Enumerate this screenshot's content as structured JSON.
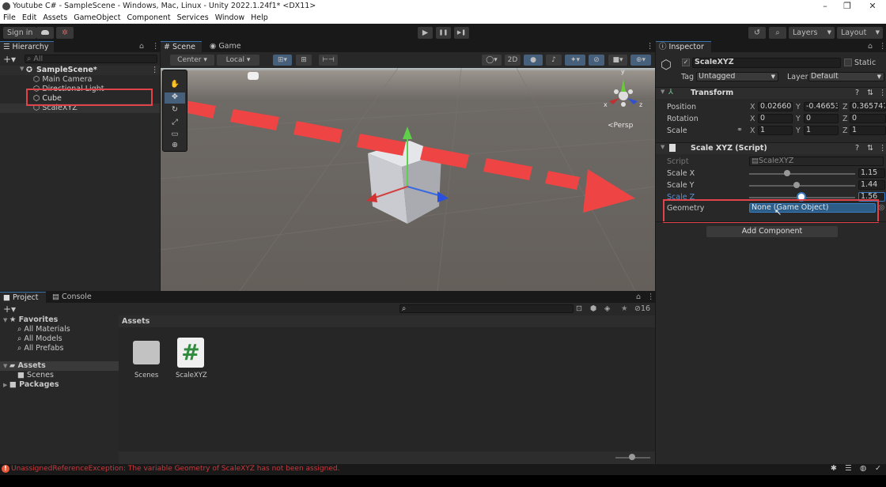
{
  "window": {
    "title": "Youtube C# - SampleScene - Windows, Mac, Linux - Unity 2022.1.24f1* <DX11>",
    "minimize": "–",
    "restore": "❐",
    "close": "✕"
  },
  "menu": [
    "File",
    "Edit",
    "Assets",
    "GameObject",
    "Component",
    "Services",
    "Window",
    "Help"
  ],
  "toolbar": {
    "sign_in": "Sign in",
    "layers": "Layers",
    "layout": "Layout",
    "play": "▶",
    "pause": "❚❚",
    "step": "▶❚"
  },
  "hierarchy": {
    "tab": "Hierarchy",
    "search_placeholder": "All",
    "scene": "SampleScene*",
    "items": [
      "Main Camera",
      "Directional Light",
      "Cube",
      "ScaleXYZ"
    ]
  },
  "scene": {
    "tabs": [
      "Scene",
      "Game"
    ],
    "pivot": "Center",
    "space": "Local",
    "mode_2d": "2D",
    "persp": "<Persp",
    "gizmo": {
      "x": "x",
      "y": "y",
      "z": "z"
    }
  },
  "inspector": {
    "tab": "Inspector",
    "object_name": "ScaleXYZ",
    "static_label": "Static",
    "tag_label": "Tag",
    "tag_value": "Untagged",
    "layer_label": "Layer",
    "layer_value": "Default",
    "transform": {
      "title": "Transform",
      "rows": [
        {
          "label": "Position",
          "x": "0.026608",
          "y": "-0.46653",
          "z": "0.365747"
        },
        {
          "label": "Rotation",
          "x": "0",
          "y": "0",
          "z": "0"
        },
        {
          "label": "Scale",
          "x": "1",
          "y": "1",
          "z": "1"
        }
      ]
    },
    "script_component": {
      "title": "Scale XYZ (Script)",
      "script_label": "Script",
      "script_value": "ScaleXYZ",
      "sliders": [
        {
          "label": "Scale X",
          "value": "1.15",
          "fraction": 0.36
        },
        {
          "label": "Scale Y",
          "value": "1.44",
          "fraction": 0.45
        },
        {
          "label": "Scale Z",
          "value": "1.56",
          "fraction": 0.49
        }
      ],
      "geometry_label": "Geometry",
      "geometry_value": "None (Game Object)"
    },
    "add_component": "Add Component"
  },
  "project": {
    "tabs": [
      "Project",
      "Console"
    ],
    "favorites": "Favorites",
    "fav_items": [
      "All Materials",
      "All Models",
      "All Prefabs"
    ],
    "assets": "Assets",
    "scenes": "Scenes",
    "packages": "Packages",
    "breadcrumb": "Assets",
    "hidden_count": "16",
    "grid": [
      {
        "name": "Scenes",
        "type": "folder"
      },
      {
        "name": "ScaleXYZ",
        "type": "script"
      }
    ]
  },
  "status": {
    "error": "UnassignedReferenceException: The variable Geometry of ScaleXYZ has not been assigned."
  },
  "colors": {
    "accent": "#2c5d87",
    "error": "#c9393d",
    "annotation": "#e0434a"
  }
}
